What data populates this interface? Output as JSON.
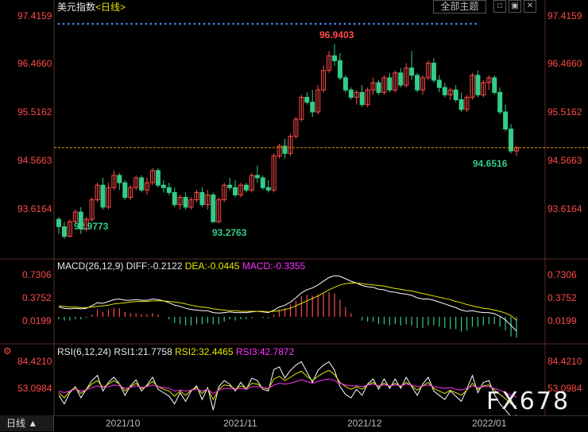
{
  "header": {
    "title": "美元指数",
    "period": "<日线>",
    "theme_button": "全部主题",
    "buttons": [
      "□",
      "▣",
      "✕"
    ]
  },
  "price_axis": {
    "ticks": [
      "97.4159",
      "96.4660",
      "95.5162",
      "94.5663",
      "93.6164"
    ]
  },
  "annotations": {
    "high": "96.9403",
    "low1": "92.9773",
    "low2": "93.2763",
    "last": "94.6516"
  },
  "macd": {
    "title": "MACD(26,12,9)",
    "diff": "DIFF:-0.2122",
    "dea": "DEA:-0.0445",
    "macd": "MACD:-0.3355",
    "ticks": [
      "0.7306",
      "0.3752",
      "0.0199"
    ]
  },
  "rsi": {
    "title": "RSI(6,12,24)",
    "rsi1": "RSI1:21.7758",
    "rsi2": "RSI2:32.4465",
    "rsi3": "RSI3:42.7872",
    "ticks": [
      "84.4210",
      "53.0984"
    ]
  },
  "x_axis": {
    "ticks": [
      "2021/10",
      "2021/11",
      "2021/12",
      "2022/01"
    ]
  },
  "footer": {
    "period_button": "日线 ▲",
    "watermark": "FX678"
  },
  "colors": {
    "up": "#ff4a4a",
    "down": "#33cc88",
    "diff": "#ffffff",
    "dea": "#e6e600",
    "rsi3": "#ff33ff",
    "grid": "#3a2020"
  },
  "chart_data": {
    "type": "candlestick",
    "title": "美元指数 日线",
    "ylim": [
      92.8,
      97.55
    ],
    "candles": [
      [
        93.35,
        93.4,
        93.05,
        93.2
      ],
      [
        93.2,
        93.3,
        92.95,
        93.0
      ],
      [
        93.0,
        93.35,
        92.98,
        93.3
      ],
      [
        93.3,
        93.55,
        93.25,
        93.5
      ],
      [
        93.5,
        93.6,
        93.05,
        93.15
      ],
      [
        93.15,
        93.4,
        93.1,
        93.35
      ],
      [
        93.35,
        93.8,
        93.3,
        93.75
      ],
      [
        93.75,
        94.1,
        93.7,
        94.05
      ],
      [
        94.05,
        94.2,
        93.55,
        93.6
      ],
      [
        93.6,
        94.1,
        93.55,
        94.0
      ],
      [
        94.0,
        94.35,
        93.95,
        94.25
      ],
      [
        94.25,
        94.3,
        93.95,
        94.1
      ],
      [
        94.1,
        94.15,
        93.75,
        93.8
      ],
      [
        93.8,
        94.05,
        93.75,
        94.0
      ],
      [
        94.0,
        94.25,
        93.95,
        94.2
      ],
      [
        94.2,
        94.25,
        93.9,
        93.95
      ],
      [
        93.95,
        94.2,
        93.85,
        94.1
      ],
      [
        94.1,
        94.4,
        94.05,
        94.35
      ],
      [
        94.35,
        94.4,
        94.0,
        94.05
      ],
      [
        94.05,
        94.15,
        93.9,
        94.0
      ],
      [
        94.0,
        94.1,
        93.85,
        93.9
      ],
      [
        93.9,
        94.0,
        93.6,
        93.65
      ],
      [
        93.65,
        93.85,
        93.55,
        93.8
      ],
      [
        93.8,
        93.9,
        93.55,
        93.6
      ],
      [
        93.6,
        93.8,
        93.55,
        93.75
      ],
      [
        93.75,
        93.95,
        93.7,
        93.9
      ],
      [
        93.9,
        94.0,
        93.6,
        93.65
      ],
      [
        93.65,
        93.95,
        93.55,
        93.85
      ],
      [
        93.85,
        93.9,
        93.28,
        93.3
      ],
      [
        93.3,
        93.8,
        93.27,
        93.75
      ],
      [
        93.75,
        94.1,
        93.7,
        94.05
      ],
      [
        94.05,
        94.2,
        93.95,
        94.0
      ],
      [
        94.0,
        94.15,
        93.8,
        93.85
      ],
      [
        93.85,
        94.1,
        93.8,
        94.05
      ],
      [
        94.05,
        94.1,
        93.9,
        93.95
      ],
      [
        93.95,
        94.3,
        93.9,
        94.25
      ],
      [
        94.25,
        94.45,
        94.1,
        94.2
      ],
      [
        94.2,
        94.25,
        93.95,
        94.0
      ],
      [
        94.0,
        94.15,
        93.9,
        93.95
      ],
      [
        93.95,
        94.7,
        93.9,
        94.65
      ],
      [
        94.65,
        94.9,
        94.6,
        94.85
      ],
      [
        94.85,
        95.0,
        94.6,
        94.7
      ],
      [
        94.7,
        95.1,
        94.65,
        95.05
      ],
      [
        95.05,
        95.45,
        95.0,
        95.4
      ],
      [
        95.4,
        95.9,
        95.35,
        95.85
      ],
      [
        95.85,
        95.95,
        95.7,
        95.75
      ],
      [
        95.75,
        96.0,
        95.45,
        95.55
      ],
      [
        95.55,
        96.1,
        95.5,
        96.0
      ],
      [
        96.0,
        96.5,
        95.95,
        96.4
      ],
      [
        96.4,
        96.8,
        96.35,
        96.7
      ],
      [
        96.7,
        96.94,
        96.5,
        96.6
      ],
      [
        96.6,
        96.75,
        96.2,
        96.25
      ],
      [
        96.25,
        96.3,
        95.95,
        96.0
      ],
      [
        96.0,
        96.05,
        95.8,
        95.85
      ],
      [
        95.85,
        96.0,
        95.7,
        95.95
      ],
      [
        95.95,
        96.1,
        95.65,
        95.7
      ],
      [
        95.7,
        96.05,
        95.65,
        96.0
      ],
      [
        96.0,
        96.25,
        95.9,
        96.15
      ],
      [
        96.15,
        96.2,
        95.9,
        95.95
      ],
      [
        95.95,
        96.3,
        95.9,
        96.25
      ],
      [
        96.25,
        96.35,
        95.95,
        96.0
      ],
      [
        96.0,
        96.4,
        95.95,
        96.35
      ],
      [
        96.35,
        96.45,
        96.05,
        96.1
      ],
      [
        96.1,
        96.55,
        96.05,
        96.45
      ],
      [
        96.45,
        96.8,
        96.2,
        96.3
      ],
      [
        96.3,
        96.35,
        95.95,
        96.0
      ],
      [
        96.0,
        96.3,
        95.9,
        96.25
      ],
      [
        96.25,
        96.6,
        96.2,
        96.55
      ],
      [
        96.55,
        96.65,
        96.15,
        96.2
      ],
      [
        96.2,
        96.3,
        95.95,
        96.05
      ],
      [
        96.05,
        96.15,
        95.85,
        95.9
      ],
      [
        95.9,
        96.05,
        95.8,
        96.0
      ],
      [
        96.0,
        96.1,
        95.75,
        95.8
      ],
      [
        95.8,
        95.95,
        95.55,
        95.6
      ],
      [
        95.6,
        95.9,
        95.55,
        95.85
      ],
      [
        95.85,
        96.35,
        95.8,
        96.3
      ],
      [
        96.3,
        96.4,
        95.85,
        95.9
      ],
      [
        95.9,
        96.2,
        95.85,
        96.15
      ],
      [
        96.15,
        96.3,
        96.0,
        96.25
      ],
      [
        96.25,
        96.3,
        95.9,
        95.95
      ],
      [
        95.95,
        96.05,
        95.5,
        95.55
      ],
      [
        95.55,
        95.7,
        95.15,
        95.2
      ],
      [
        95.2,
        95.3,
        94.7,
        94.75
      ],
      [
        94.75,
        94.85,
        94.65,
        94.82
      ]
    ],
    "macd_diff": [
      0.18,
      0.16,
      0.15,
      0.16,
      0.15,
      0.16,
      0.2,
      0.25,
      0.24,
      0.27,
      0.3,
      0.31,
      0.29,
      0.29,
      0.3,
      0.29,
      0.29,
      0.31,
      0.3,
      0.28,
      0.25,
      0.21,
      0.19,
      0.16,
      0.14,
      0.13,
      0.12,
      0.12,
      0.09,
      0.08,
      0.09,
      0.1,
      0.09,
      0.09,
      0.09,
      0.1,
      0.11,
      0.1,
      0.09,
      0.13,
      0.18,
      0.21,
      0.26,
      0.33,
      0.41,
      0.46,
      0.49,
      0.54,
      0.6,
      0.66,
      0.69,
      0.68,
      0.64,
      0.6,
      0.57,
      0.53,
      0.51,
      0.5,
      0.47,
      0.46,
      0.43,
      0.42,
      0.4,
      0.39,
      0.37,
      0.33,
      0.31,
      0.31,
      0.29,
      0.26,
      0.23,
      0.2,
      0.17,
      0.13,
      0.11,
      0.12,
      0.1,
      0.09,
      0.09,
      0.07,
      0.03,
      -0.03,
      -0.12,
      -0.21
    ],
    "macd_dea": [
      0.2,
      0.19,
      0.18,
      0.18,
      0.17,
      0.17,
      0.18,
      0.19,
      0.2,
      0.21,
      0.23,
      0.24,
      0.25,
      0.26,
      0.27,
      0.27,
      0.27,
      0.28,
      0.28,
      0.28,
      0.27,
      0.26,
      0.25,
      0.23,
      0.21,
      0.19,
      0.18,
      0.17,
      0.15,
      0.14,
      0.13,
      0.12,
      0.12,
      0.11,
      0.11,
      0.11,
      0.11,
      0.11,
      0.1,
      0.11,
      0.12,
      0.14,
      0.16,
      0.2,
      0.24,
      0.28,
      0.32,
      0.36,
      0.41,
      0.46,
      0.5,
      0.54,
      0.56,
      0.57,
      0.57,
      0.56,
      0.55,
      0.54,
      0.53,
      0.52,
      0.5,
      0.48,
      0.47,
      0.45,
      0.44,
      0.42,
      0.4,
      0.38,
      0.36,
      0.34,
      0.32,
      0.3,
      0.27,
      0.25,
      0.22,
      0.2,
      0.18,
      0.16,
      0.15,
      0.13,
      0.11,
      0.08,
      0.04,
      -0.04
    ],
    "rsi1": [
      45,
      35,
      48,
      55,
      42,
      52,
      62,
      68,
      50,
      60,
      66,
      58,
      45,
      56,
      63,
      50,
      57,
      66,
      52,
      48,
      44,
      35,
      48,
      38,
      50,
      56,
      40,
      54,
      28,
      55,
      62,
      58,
      50,
      60,
      52,
      65,
      62,
      52,
      50,
      75,
      78,
      65,
      74,
      80,
      84,
      72,
      60,
      74,
      80,
      84,
      74,
      55,
      46,
      42,
      52,
      45,
      58,
      64,
      52,
      64,
      53,
      64,
      53,
      66,
      55,
      45,
      58,
      66,
      50,
      45,
      40,
      50,
      44,
      38,
      52,
      68,
      48,
      60,
      62,
      46,
      35,
      28,
      20,
      22
    ],
    "rsi2": [
      48,
      42,
      50,
      54,
      47,
      52,
      58,
      62,
      54,
      58,
      62,
      58,
      50,
      55,
      59,
      53,
      56,
      61,
      55,
      52,
      50,
      44,
      50,
      45,
      51,
      54,
      47,
      53,
      40,
      52,
      57,
      56,
      52,
      56,
      53,
      59,
      58,
      54,
      52,
      64,
      67,
      62,
      66,
      70,
      73,
      67,
      62,
      67,
      71,
      74,
      69,
      60,
      55,
      52,
      55,
      52,
      57,
      60,
      55,
      59,
      55,
      59,
      55,
      60,
      56,
      51,
      56,
      60,
      53,
      50,
      47,
      51,
      48,
      45,
      51,
      59,
      52,
      56,
      57,
      51,
      46,
      41,
      35,
      32
    ],
    "rsi3": [
      50,
      48,
      50,
      52,
      50,
      51,
      54,
      56,
      54,
      55,
      57,
      56,
      53,
      54,
      56,
      54,
      55,
      57,
      55,
      54,
      53,
      50,
      51,
      50,
      51,
      52,
      50,
      52,
      47,
      51,
      53,
      53,
      52,
      53,
      52,
      55,
      55,
      54,
      53,
      57,
      59,
      58,
      59,
      61,
      63,
      61,
      59,
      61,
      63,
      64,
      62,
      59,
      57,
      56,
      56,
      55,
      57,
      58,
      56,
      57,
      56,
      57,
      56,
      58,
      57,
      55,
      56,
      57,
      55,
      54,
      53,
      54,
      52,
      51,
      53,
      56,
      54,
      55,
      55,
      53,
      51,
      48,
      45,
      43
    ]
  }
}
